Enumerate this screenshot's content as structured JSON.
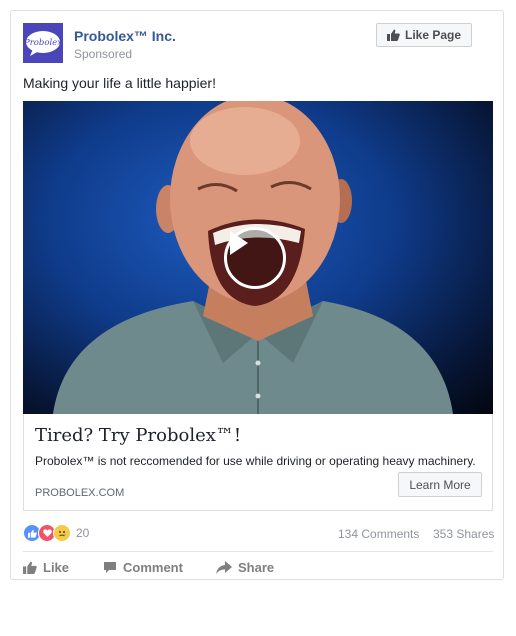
{
  "post": {
    "page_name": "Probolex™ Inc.",
    "sponsored_label": "Sponsored",
    "avatar_text": "Probolex",
    "like_page_label": "Like Page",
    "caption": "Making your life a little happier!"
  },
  "link_preview": {
    "title": "Tired? Try Probolex™!",
    "description": "Probolex™ is not reccomended for use while driving or operating heavy machinery.",
    "domain": "PROBOLEX.COM",
    "cta_label": "Learn More"
  },
  "engagement": {
    "reaction_count": "20",
    "reactions": [
      "like-reaction-icon",
      "love-reaction-icon",
      "sad-reaction-icon"
    ],
    "comments": "134 Comments",
    "shares": "353 Shares"
  },
  "actions": {
    "like": "Like",
    "comment": "Comment",
    "share": "Share"
  },
  "colors": {
    "brand": "#4a45b8",
    "link": "#365899",
    "muted": "#90949c",
    "like_blue": "#5890ff",
    "love_red": "#f25268",
    "sad_yellow": "#f7c94b"
  }
}
